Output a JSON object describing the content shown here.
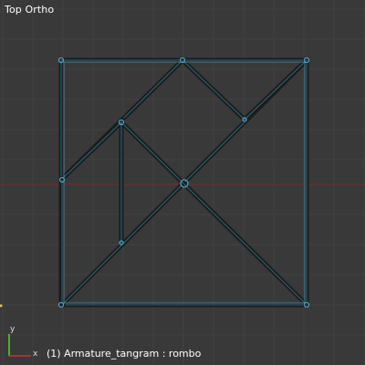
{
  "viewport": {
    "view_name": "Top Ortho",
    "status_text": "(1) Armature_tangram : rombo",
    "axes": {
      "x_label": "x",
      "y_label": "y"
    },
    "colors": {
      "background": "#393939",
      "grid": "#414141",
      "x_axis": "#7a2a2a",
      "bone_outline": "#1c1c1c",
      "bone_edge": "#2f6a80",
      "joint": "#4fa0c0",
      "gizmo_x": "#c8322d",
      "gizmo_y": "#6ec83c"
    }
  }
}
